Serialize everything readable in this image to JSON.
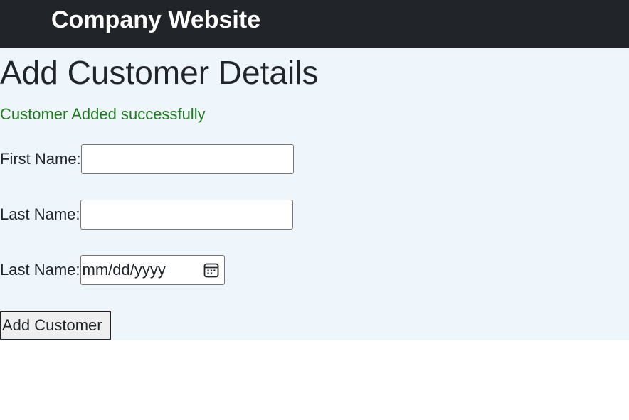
{
  "header": {
    "brand": "Company Website"
  },
  "main": {
    "title": "Add Customer Details",
    "status_message": "Customer Added successfully",
    "form": {
      "first_name": {
        "label": "First Name:",
        "value": "",
        "placeholder": ""
      },
      "last_name": {
        "label": "Last Name:",
        "value": "",
        "placeholder": ""
      },
      "date_field": {
        "label": "Last Name:",
        "placeholder": "mm/dd/yyyy",
        "icon": "calendar-icon"
      },
      "submit_label": "Add Customer"
    }
  },
  "colors": {
    "header_bg": "#212529",
    "content_bg": "#eef6fc",
    "success_text": "#1f7a1f"
  }
}
